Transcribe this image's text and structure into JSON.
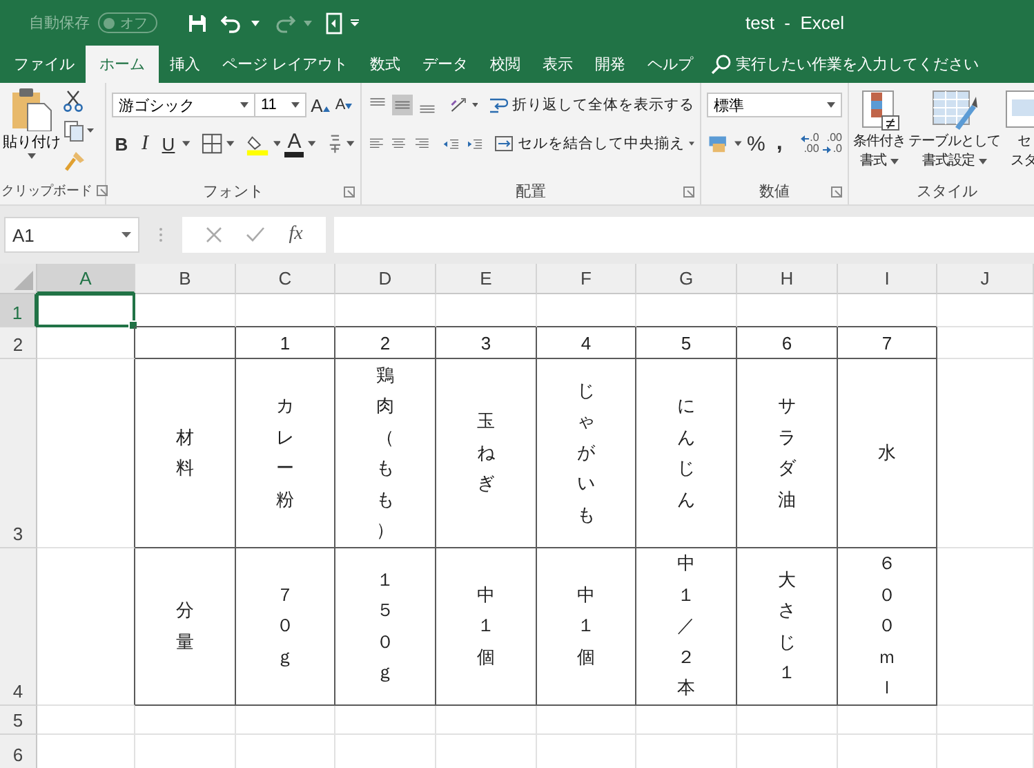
{
  "title_bar": {
    "autosave": {
      "label": "自動保存",
      "toggle_text": "オフ",
      "on": false
    },
    "title": "test  -  Excel"
  },
  "tabs": [
    {
      "label": "ファイル",
      "selected": false
    },
    {
      "label": "ホーム",
      "selected": true
    },
    {
      "label": "挿入",
      "selected": false
    },
    {
      "label": "ページ レイアウト",
      "selected": false
    },
    {
      "label": "数式",
      "selected": false
    },
    {
      "label": "データ",
      "selected": false
    },
    {
      "label": "校閲",
      "selected": false
    },
    {
      "label": "表示",
      "selected": false
    },
    {
      "label": "開発",
      "selected": false
    },
    {
      "label": "ヘルプ",
      "selected": false
    }
  ],
  "tell_me": {
    "placeholder": "実行したい作業を入力してください"
  },
  "ribbon": {
    "clipboard": {
      "paste": "貼り付け",
      "label": "クリップボード"
    },
    "font": {
      "name": "游ゴシック",
      "size": "11",
      "grow": "A",
      "shrink": "A",
      "bold": "B",
      "italic": "I",
      "underline": "U",
      "font_color": "A",
      "label": "フォント"
    },
    "alignment": {
      "vertical": [
        {
          "kind": "top",
          "selected": false
        },
        {
          "kind": "middle",
          "selected": true
        },
        {
          "kind": "bottom",
          "selected": false
        }
      ],
      "wrap": "折り返して全体を表示する",
      "merge": "セルを結合して中央揃え",
      "label": "配置"
    },
    "number": {
      "format": "標準",
      "percent": "%",
      "comma": ",",
      "increase_decimal": [
        ".0",
        ".00"
      ],
      "decrease_decimal": [
        ".00",
        ".0"
      ],
      "label": "数値"
    },
    "styles": {
      "buttons": [
        {
          "kind": "conditional",
          "lines": [
            "条件付き",
            "書式"
          ]
        },
        {
          "kind": "table",
          "lines": [
            "テーブルとして",
            "書式設定"
          ]
        },
        {
          "kind": "cell",
          "lines": [
            "セ",
            "スタ"
          ]
        }
      ],
      "label": "スタイル"
    }
  },
  "formula_bar": {
    "name_box": "A1",
    "fx": "fx"
  },
  "sheet": {
    "columns": [
      {
        "label": "A",
        "selected": true
      },
      {
        "label": "B",
        "selected": false
      },
      {
        "label": "C",
        "selected": false
      },
      {
        "label": "D",
        "selected": false
      },
      {
        "label": "E",
        "selected": false
      },
      {
        "label": "F",
        "selected": false
      },
      {
        "label": "G",
        "selected": false
      },
      {
        "label": "H",
        "selected": false
      },
      {
        "label": "I",
        "selected": false
      },
      {
        "label": "J",
        "selected": false
      }
    ],
    "rows": [
      {
        "label": "1",
        "selected": true
      },
      {
        "label": "2",
        "selected": false
      },
      {
        "label": "3",
        "selected": false
      },
      {
        "label": "4",
        "selected": false
      },
      {
        "label": "5",
        "selected": false
      },
      {
        "label": "6",
        "selected": false
      }
    ]
  },
  "table": {
    "header": [
      "1",
      "2",
      "3",
      "4",
      "5",
      "6",
      "7"
    ],
    "rows": [
      {
        "label": "材料",
        "values": [
          "カレー粉",
          "鶏肉（もも）",
          "玉ねぎ",
          "じゃがいも",
          "にんじん",
          "サラダ油",
          "水"
        ]
      },
      {
        "label": "分量",
        "values": [
          "７０ｇ",
          "１５０ｇ",
          "中１個",
          "中１個",
          "中１／２本",
          "大さじ１",
          "６００ｍｌ"
        ]
      }
    ]
  }
}
